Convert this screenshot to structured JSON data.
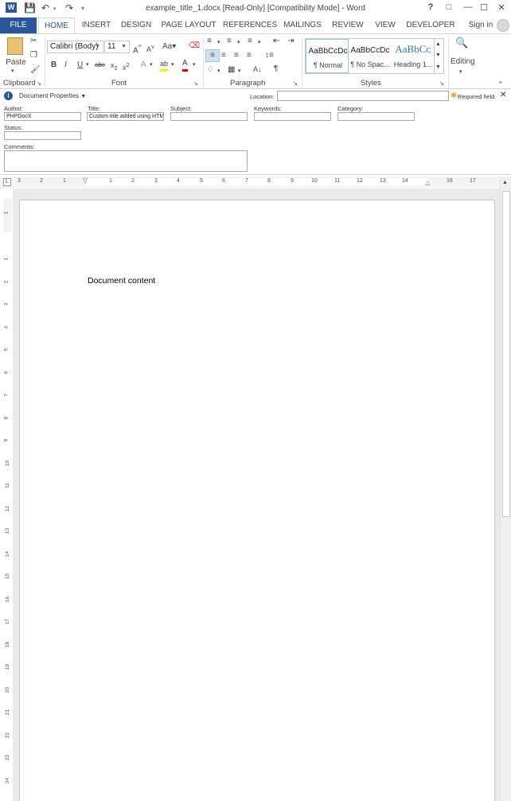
{
  "window": {
    "title": "example_title_1.docx [Read-Only] [Compatibility Mode] - Word",
    "help": "?",
    "restore": "□",
    "minimize": "—",
    "maximize": "☐",
    "close": "✕"
  },
  "tabs": [
    "FILE",
    "HOME",
    "INSERT",
    "DESIGN",
    "PAGE LAYOUT",
    "REFERENCES",
    "MAILINGS",
    "REVIEW",
    "VIEW",
    "DEVELOPER"
  ],
  "sign_in": "Sign in",
  "ribbon": {
    "clipboard": {
      "label": "Clipboard",
      "paste": "Paste"
    },
    "font": {
      "label": "Font",
      "font_name": "Calibri (Body)",
      "font_size": "11",
      "case": "Aa"
    },
    "paragraph": {
      "label": "Paragraph"
    },
    "styles": {
      "label": "Styles",
      "items": [
        {
          "sample": "AaBbCcDc",
          "name": "¶ Normal"
        },
        {
          "sample": "AaBbCcDc",
          "name": "¶ No Spac..."
        },
        {
          "sample": "AaBbCᴄ",
          "name": "Heading 1..."
        }
      ]
    },
    "editing": {
      "label": "Editing"
    }
  },
  "doc_props": {
    "header": "Document Properties",
    "location_label": "Location:",
    "required": "Required field",
    "author_label": "Author:",
    "author_value": "PHPDocX",
    "title_label": "Title:",
    "title_value": "Custom title added using HTML",
    "subject_label": "Subject:",
    "keywords_label": "Keywords:",
    "category_label": "Category:",
    "status_label": "Status:",
    "comments_label": "Comments:"
  },
  "ruler": {
    "h": [
      "3",
      "2",
      "1",
      "1",
      "2",
      "3",
      "4",
      "5",
      "6",
      "7",
      "8",
      "9",
      "10",
      "11",
      "12",
      "13",
      "14",
      "15",
      "16",
      "17"
    ],
    "v": [
      "1",
      "1",
      "2",
      "3",
      "4",
      "5",
      "6",
      "7",
      "8",
      "9",
      "10",
      "11",
      "12",
      "13",
      "14",
      "15",
      "16",
      "17",
      "18",
      "19",
      "20",
      "21",
      "22",
      "23",
      "24"
    ]
  },
  "document": {
    "content": "Document content"
  }
}
